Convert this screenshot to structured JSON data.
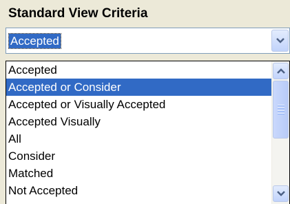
{
  "heading": "Standard View Criteria",
  "combo": {
    "selected_value": "Accepted",
    "button_icon": "chevron-down-icon"
  },
  "list": {
    "items": [
      "Accepted",
      "Accepted or Consider",
      "Accepted or Visually Accepted",
      "Accepted Visually",
      "All",
      "Consider",
      "Matched",
      "Not Accepted"
    ],
    "highlighted_item": "Accepted or Consider"
  },
  "scrollbar": {
    "up_icon": "chevron-up-icon",
    "down_icon": "chevron-down-icon"
  },
  "colors": {
    "selection": "#316ac5",
    "face": "#ece9d8",
    "scroll_button": "#c1d3fb"
  }
}
